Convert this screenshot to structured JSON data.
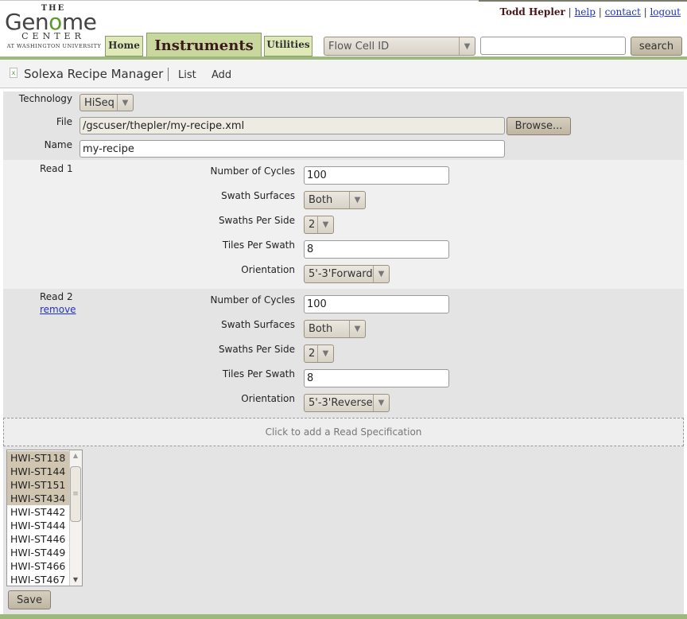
{
  "header": {
    "logo": {
      "the": "THE",
      "genome": "Genome",
      "center": "CENTER",
      "sub": "AT WASHINGTON UNIVERSITY"
    },
    "user": "Todd Hepler",
    "links": [
      "help",
      "contact",
      "logout"
    ],
    "tabs": {
      "home": "Home",
      "instruments": "Instruments",
      "utilities": "Utilities"
    },
    "search_type": "Flow Cell ID",
    "search_value": "",
    "search_button": "search"
  },
  "subnav": {
    "title": "Solexa Recipe Manager",
    "list": "List",
    "add": "Add"
  },
  "form": {
    "technology_label": "Technology",
    "technology_value": "HiSeq",
    "file_label": "File",
    "file_value": "/gscuser/thepler/my-recipe.xml",
    "browse_label": "Browse...",
    "name_label": "Name",
    "name_value": "my-recipe"
  },
  "reads": [
    {
      "label": "Read 1",
      "cycles_label": "Number of Cycles",
      "cycles_value": "100",
      "surfaces_label": "Swath Surfaces",
      "surfaces_value": "Both",
      "swaths_label": "Swaths Per Side",
      "swaths_value": "2",
      "tiles_label": "Tiles Per Swath",
      "tiles_value": "8",
      "orientation_label": "Orientation",
      "orientation_value": "5'-3'Forward"
    },
    {
      "label": "Read 2",
      "remove_label": "remove",
      "cycles_label": "Number of Cycles",
      "cycles_value": "100",
      "surfaces_label": "Swath Surfaces",
      "surfaces_value": "Both",
      "swaths_label": "Swaths Per Side",
      "swaths_value": "2",
      "tiles_label": "Tiles Per Swath",
      "tiles_value": "8",
      "orientation_label": "Orientation",
      "orientation_value": "5'-3'Reverse"
    }
  ],
  "add_read_label": "Click to add a Read Specification",
  "instruments": [
    {
      "name": "HWI-ST118",
      "selected": true
    },
    {
      "name": "HWI-ST144",
      "selected": true
    },
    {
      "name": "HWI-ST151",
      "selected": true
    },
    {
      "name": "HWI-ST434",
      "selected": true
    },
    {
      "name": "HWI-ST442",
      "selected": false
    },
    {
      "name": "HWI-ST444",
      "selected": false
    },
    {
      "name": "HWI-ST446",
      "selected": false
    },
    {
      "name": "HWI-ST449",
      "selected": false
    },
    {
      "name": "HWI-ST466",
      "selected": false
    },
    {
      "name": "HWI-ST467",
      "selected": false
    }
  ],
  "save_label": "Save",
  "colors": {
    "accent_green": "#9cb87a",
    "tab_green": "#dfe9b8",
    "selection": "#cfc5b0",
    "link": "#2233bb"
  },
  "icons": [
    "dropdown-arrow-icon",
    "recipe-app-icon",
    "scroll-up-icon",
    "scroll-down-icon"
  ]
}
